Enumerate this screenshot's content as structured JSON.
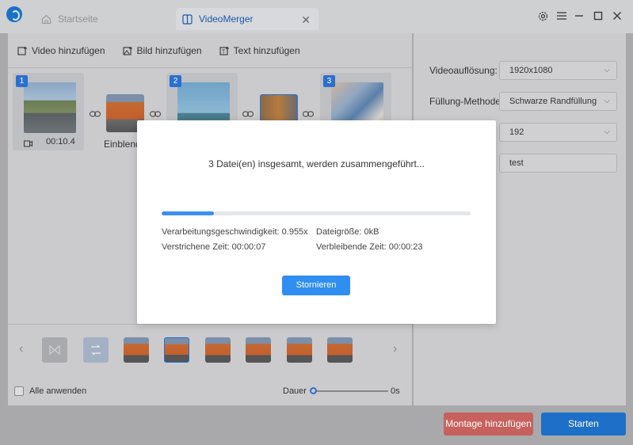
{
  "titlebar": {
    "tab_home": "Startseite",
    "tab_merger": "VideoMerger"
  },
  "toolbar": {
    "add_video": "Video hinzufügen",
    "add_image": "Bild hinzufügen",
    "add_text": "Text hinzufügen"
  },
  "clips": [
    {
      "number": "1",
      "duration": "00:10.4"
    },
    {
      "number": "2"
    },
    {
      "number": "3"
    }
  ],
  "transition": {
    "label": "Einblend"
  },
  "bottom": {
    "apply_all": "Alle anwenden",
    "duration_label": "Dauer",
    "duration_value": "0s"
  },
  "settings": {
    "resolution_label": "Videoauflösung:",
    "resolution_value": "1920x1080",
    "fill_label": "Füllung-Methode:",
    "fill_value": "Schwarze Randfüllung",
    "third_value": "192",
    "fourth_value": "test"
  },
  "actions": {
    "montage": "Montage hinzufügen",
    "start": "Starten"
  },
  "modal": {
    "title": "3 Datei(en) insgesamt, werden zusammengeführt...",
    "progress": 0.17,
    "speed": "Verarbeitungsgeschwindigkeit: 0.955x",
    "filesize": "Dateigröße: 0kB",
    "elapsed": "Verstrichene Zeit: 00:00:07",
    "remaining": "Verbleibende Zeit: 00:00:23",
    "cancel": "Stornieren"
  },
  "colors": {
    "accent": "#2f8ef0",
    "montage": "#c6615d",
    "start": "#1e6fc7"
  }
}
